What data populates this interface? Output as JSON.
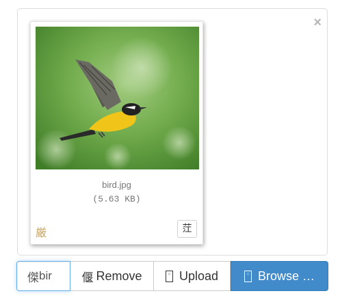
{
  "preview": {
    "close_label": "×",
    "file_name": "bird.jpg",
    "file_size": "(5.63 KB)",
    "status_icon": "厳",
    "zoom_icon": "茳"
  },
  "toolbar": {
    "caption_icon": "傑",
    "caption_text": "bir",
    "remove_icon": "偃",
    "remove_label": "Remove",
    "upload_label": "Upload",
    "browse_label": "Browse …"
  },
  "colors": {
    "accent": "#428bca",
    "focus_border": "#66afe9"
  }
}
